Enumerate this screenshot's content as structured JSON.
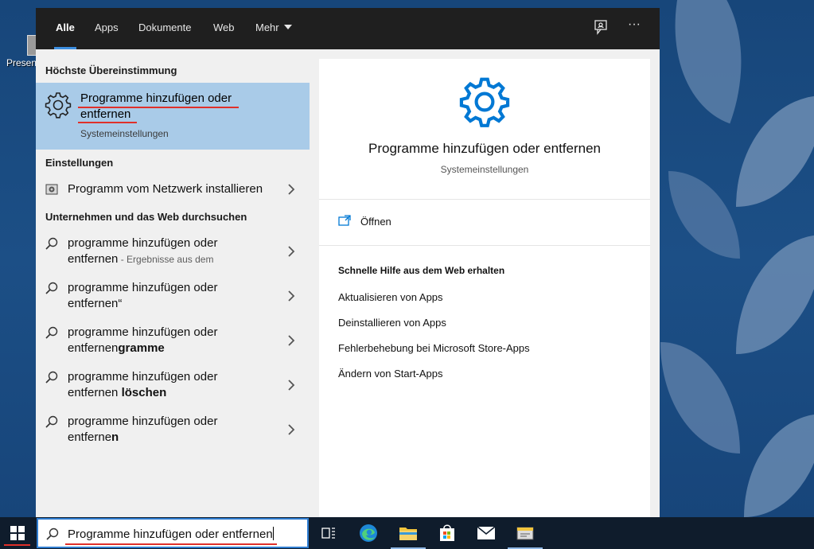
{
  "desktop": {
    "icon_label": "Present"
  },
  "tabs": [
    {
      "label": "Alle"
    },
    {
      "label": "Apps"
    },
    {
      "label": "Dokumente"
    },
    {
      "label": "Web"
    },
    {
      "label": "Mehr"
    }
  ],
  "sections": {
    "best_match": "Höchste Übereinstimmung",
    "settings": "Einstellungen",
    "web": "Unternehmen und das Web durchsuchen"
  },
  "best_match": {
    "title": "Programme hinzufügen oder entfernen",
    "subtitle": "Systemeinstellungen",
    "icon": "gear-icon"
  },
  "settings_items": [
    {
      "label": "Programm vom Netzwerk installieren",
      "icon": "network-install-icon"
    }
  ],
  "web_suggestions": [
    {
      "line1": "programme hinzufügen oder",
      "line2": "entfernen",
      "line2_bold": "",
      "suffix": " - Ergebnisse aus dem"
    },
    {
      "line1": "programme hinzufügen oder",
      "line2": "entfernen“",
      "line2_bold": "",
      "suffix": ""
    },
    {
      "line1": "programme hinzufügen oder",
      "line2": "entfernen",
      "line2_bold": "gramme",
      "suffix": ""
    },
    {
      "line1": "programme hinzufügen oder",
      "line2": "entfernen ",
      "line2_bold": "löschen",
      "suffix": ""
    },
    {
      "line1": "programme hinzufügen oder",
      "line2": "entferne",
      "line2_bold": "n",
      "suffix": ""
    }
  ],
  "preview": {
    "title": "Programme hinzufügen oder entfernen",
    "subtitle": "Systemeinstellungen",
    "open_label": "Öffnen",
    "help_heading": "Schnelle Hilfe aus dem Web erhalten",
    "help_links": [
      "Aktualisieren von Apps",
      "Deinstallieren von Apps",
      "Fehlerbehebung bei Microsoft Store-Apps",
      "Ändern von Start-Apps"
    ]
  },
  "search": {
    "value": "Programme hinzufügen oder entfernen"
  },
  "taskbar_apps": [
    "task-view-icon",
    "edge-icon",
    "file-explorer-icon",
    "store-icon",
    "mail-icon",
    "settings-app-icon"
  ],
  "colors": {
    "accent": "#0078d4",
    "selected": "#a9cbe8",
    "underline": "#e0302a"
  }
}
